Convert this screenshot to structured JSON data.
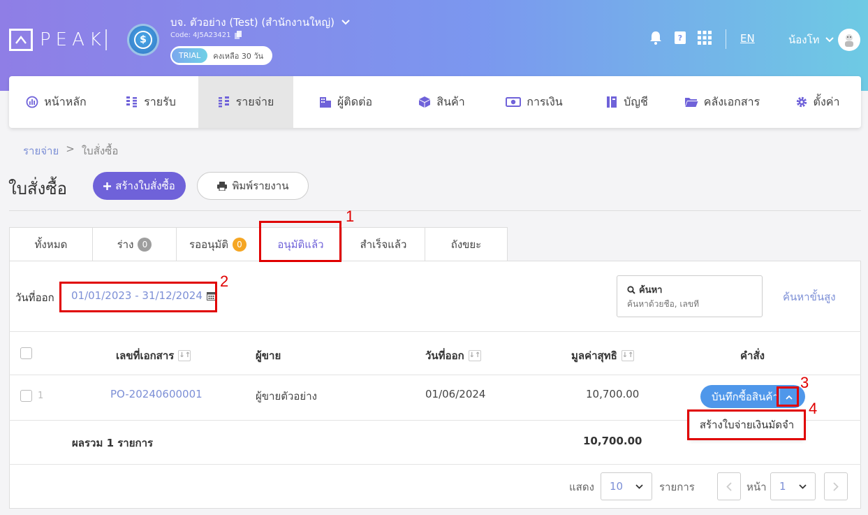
{
  "brand": {
    "logo_text": "PEAK"
  },
  "company": {
    "name": "บจ. ตัวอย่าง (Test) (สำนักงานใหญ่)",
    "code": "Code: 4J5A23421",
    "trial_badge": "TRIAL",
    "trial_left": "คงเหลือ 30 วัน"
  },
  "topbar": {
    "language": "EN",
    "user_name": "น้องโท"
  },
  "nav": {
    "items": [
      {
        "label": "หน้าหลัก",
        "icon": "dashboard-icon"
      },
      {
        "label": "รายรับ",
        "icon": "income-icon"
      },
      {
        "label": "รายจ่าย",
        "icon": "expense-icon"
      },
      {
        "label": "ผู้ติดต่อ",
        "icon": "contacts-icon"
      },
      {
        "label": "สินค้า",
        "icon": "box-icon"
      },
      {
        "label": "การเงิน",
        "icon": "money-icon"
      },
      {
        "label": "บัญชี",
        "icon": "ledger-icon"
      },
      {
        "label": "คลังเอกสาร",
        "icon": "folder-icon"
      },
      {
        "label": "ตั้งค่า",
        "icon": "gear-icon"
      }
    ],
    "active_index": 2
  },
  "breadcrumb": {
    "parent": "รายจ่าย",
    "separator": ">",
    "current": "ใบสั่งซื้อ"
  },
  "page": {
    "title": "ใบสั่งซื้อ",
    "create_button": "สร้างใบสั่งซื้อ",
    "print_button": "พิมพ์รายงาน"
  },
  "tabs": [
    {
      "label": "ทั้งหมด"
    },
    {
      "label": "ร่าง",
      "count": "0",
      "badge_color": "#9e9e9e"
    },
    {
      "label": "รออนุมัติ",
      "count": "0",
      "badge_color": "#f5a623"
    },
    {
      "label": "อนุมัติแล้ว"
    },
    {
      "label": "สำเร็จแล้ว"
    },
    {
      "label": "ถังขยะ"
    }
  ],
  "filter": {
    "label": "วันที่ออก",
    "date_range": "01/01/2023 - 31/12/2024"
  },
  "search": {
    "label": "ค้นหา",
    "placeholder": "ค้นหาด้วยชื่อ, เลขที่",
    "advanced": "ค้นหาขั้นสูง"
  },
  "table": {
    "headers": {
      "doc_no": "เลขที่เอกสาร",
      "vendor": "ผู้ขาย",
      "date": "วันที่ออก",
      "net": "มูลค่าสุทธิ",
      "action": "คำสั่ง"
    },
    "rows": [
      {
        "num": "1",
        "doc_no": "PO-20240600001",
        "vendor": "ผู้ขายตัวอย่าง",
        "date": "01/06/2024",
        "net": "10,700.00",
        "action": "บันทึกซื้อสินค้า"
      }
    ],
    "dropdown_item": "สร้างใบจ่ายเงินมัดจำ",
    "total_label": "ผลรวม 1 รายการ",
    "total_value": "10,700.00"
  },
  "pager": {
    "show_label": "แสดง",
    "page_size": "10",
    "items_label": "รายการ",
    "page_label": "หน้า",
    "page": "1"
  },
  "annotations": [
    "1",
    "2",
    "3",
    "4"
  ],
  "colors": {
    "accent": "#6f62d9",
    "link": "#7c8fd6",
    "action_button": "#4f97ea",
    "annotation": "#e00000"
  }
}
